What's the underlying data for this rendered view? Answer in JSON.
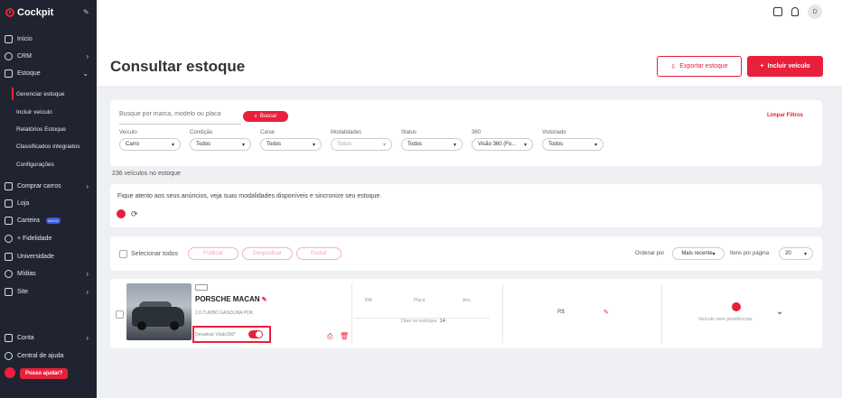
{
  "app": {
    "name": "Cockpit"
  },
  "sidebar": {
    "items": [
      {
        "label": "Início"
      },
      {
        "label": "CRM"
      },
      {
        "label": "Estoque"
      },
      {
        "label": "Comprar carros"
      },
      {
        "label": "Loja"
      },
      {
        "label": "Carteira",
        "badge": "NOVO"
      },
      {
        "label": "+ Fidelidade"
      },
      {
        "label": "Universidade"
      },
      {
        "label": "Mídias"
      },
      {
        "label": "Site"
      },
      {
        "label": "Conta"
      },
      {
        "label": "Central de ajuda"
      }
    ],
    "sub_items": [
      {
        "label": "Gerenciar estoque"
      },
      {
        "label": "Incluir veículo"
      },
      {
        "label": "Relatórios Estoque"
      },
      {
        "label": "Classificados integrados"
      },
      {
        "label": "Configurações"
      }
    ],
    "help_button": "Posso ajudar?"
  },
  "header": {
    "avatar_initial": "D"
  },
  "page": {
    "title": "Consultar estoque",
    "export_button": "Exportar estoque",
    "add_button": "Incluir veículo"
  },
  "filters": {
    "search_placeholder": "Busque por marca, modelo ou placa",
    "search_button": "Buscar",
    "clear": "Limpar Filtros",
    "fields": [
      {
        "label": "Veículo",
        "value": "Carro"
      },
      {
        "label": "Condição",
        "value": "Todos"
      },
      {
        "label": "Canal",
        "value": "Todos"
      },
      {
        "label": "Modalidades",
        "value": "Todos"
      },
      {
        "label": "Status",
        "value": "Todos"
      },
      {
        "label": "360",
        "value": "Visão 360 (Fo..."
      },
      {
        "label": "Vistoriado",
        "value": "Todos"
      }
    ]
  },
  "count_text": "236 veículos no estoque",
  "notice": {
    "text": "Fique atento aos seus anúncios, veja suas modalidades disponíveis e sincronize seu estoque."
  },
  "toolbar": {
    "select_all": "Selecionar todos",
    "publish": "Publicar",
    "unpublish": "Despublicar",
    "delete": "Excluir",
    "order_label": "Ordenar por",
    "order_value": "Mais recente",
    "per_page_label": "Itens por página",
    "per_page_value": "20"
  },
  "vehicle": {
    "name": "PORSCHE MACAN",
    "description": "2.0 TURBO GASOLINA PDK",
    "v360_label": "Desativar Visão360°",
    "km_label": "KM",
    "plate_label": "Placa",
    "year_label": "Ano",
    "stock_days_label": "Dias no estoque",
    "stock_days_value": "14",
    "price": "R$",
    "pending": "Veículo sem pendências"
  },
  "colors": {
    "accent": "#e8203b",
    "sidebar": "#1f2430"
  }
}
